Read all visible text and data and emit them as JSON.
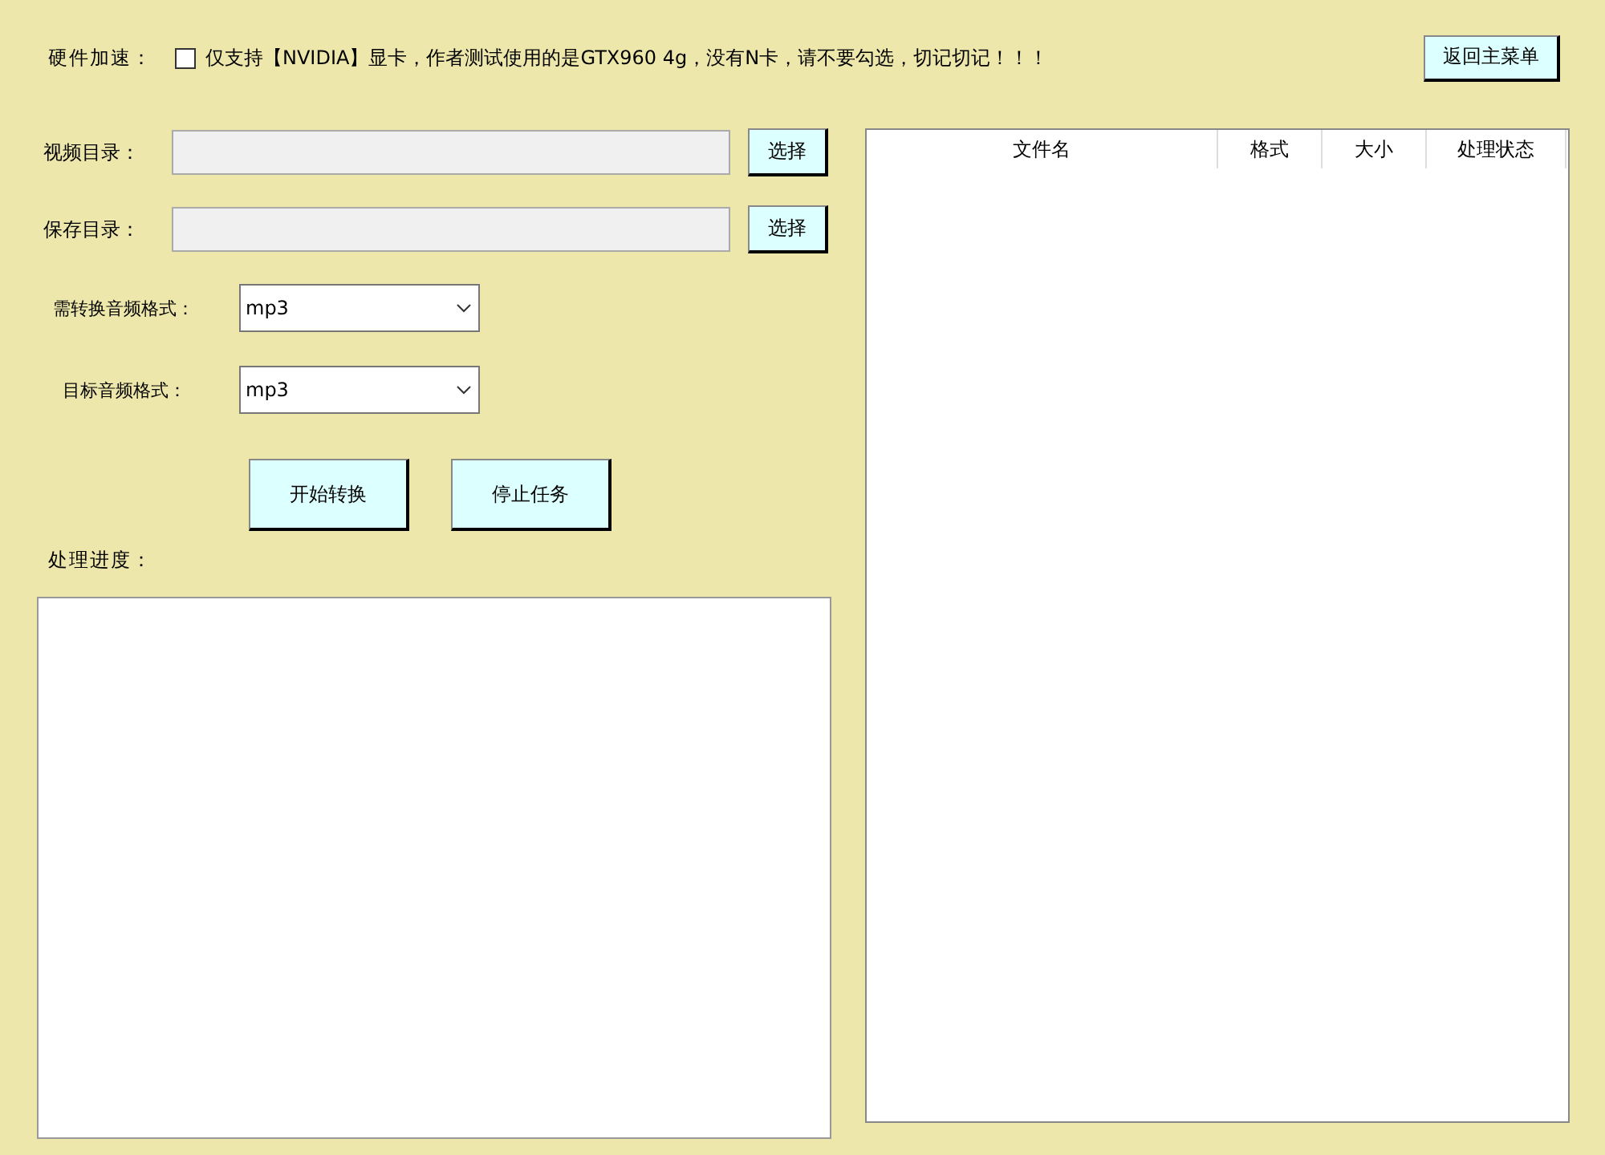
{
  "hardware_acceleration": {
    "label": "硬件加速：",
    "checked": false,
    "note": "仅支持【NVIDIA】显卡，作者测试使用的是GTX960 4g，没有N卡，请不要勾选，切记切记！！！"
  },
  "main_menu_button": "返回主菜单",
  "directories": [
    {
      "label": "视频目录：",
      "button": "选择"
    },
    {
      "label": "保存目录：",
      "button": "选择"
    }
  ],
  "formats": [
    {
      "label": "需转换音频格式：",
      "value": "mp3"
    },
    {
      "label": "目标音频格式：",
      "value": "mp3"
    }
  ],
  "actions": [
    "开始转换",
    "停止任务"
  ],
  "progress": {
    "label": "处理进度："
  },
  "file_table": {
    "columns": [
      "文件名",
      "格式",
      "大小",
      "处理状态"
    ]
  }
}
